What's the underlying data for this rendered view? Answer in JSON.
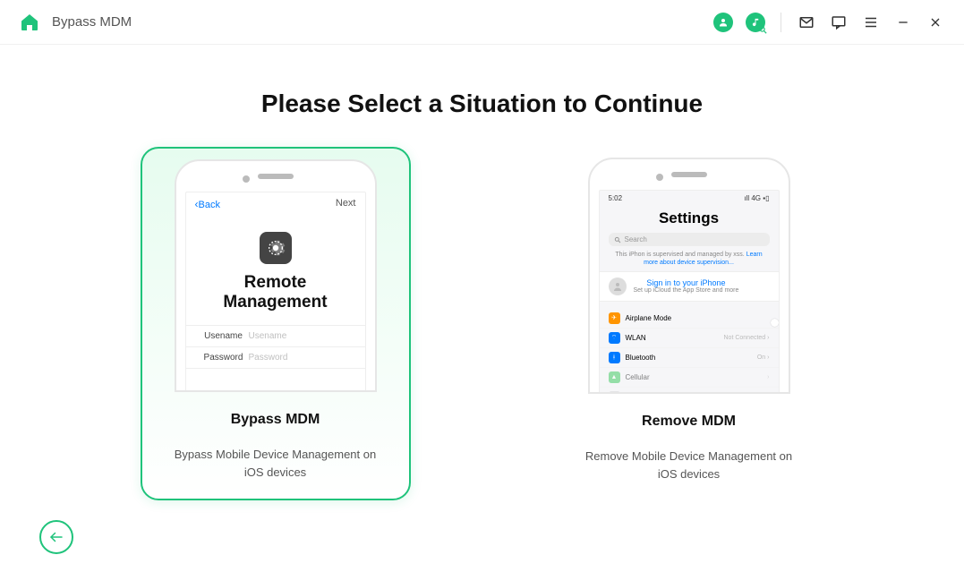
{
  "header": {
    "title": "Bypass MDM"
  },
  "main": {
    "heading": "Please Select a Situation to Continue"
  },
  "options": {
    "bypass": {
      "title": "Bypass MDM",
      "desc": "Bypass Mobile Device Management on iOS devices",
      "screen": {
        "back": "Back",
        "next": "Next",
        "remote_title_l1": "Remote",
        "remote_title_l2": "Management",
        "username_label": "Usename",
        "username_ph": "Usename",
        "password_label": "Password",
        "password_ph": "Password"
      }
    },
    "remove": {
      "title": "Remove MDM",
      "desc": "Remove Mobile Device Management on iOS devices",
      "screen": {
        "time": "5:02",
        "signal": "ıll 4G ▪▯",
        "settings": "Settings",
        "search_ph": "Search",
        "supervision_text": "This iPhon is supervised and managed by xss. ",
        "supervision_link": "Learn more about device supervision...",
        "signin_title": "Sign in to your iPhone",
        "signin_sub": "Set up iCloud the App Store and more",
        "rows": {
          "airplane": "Airplane Mode",
          "wlan": "WLAN",
          "wlan_value": "Not Connected",
          "bluetooth": "Bluetooth",
          "bluetooth_value": "On",
          "cellular": "Cellular"
        },
        "chevron": "›"
      }
    }
  }
}
